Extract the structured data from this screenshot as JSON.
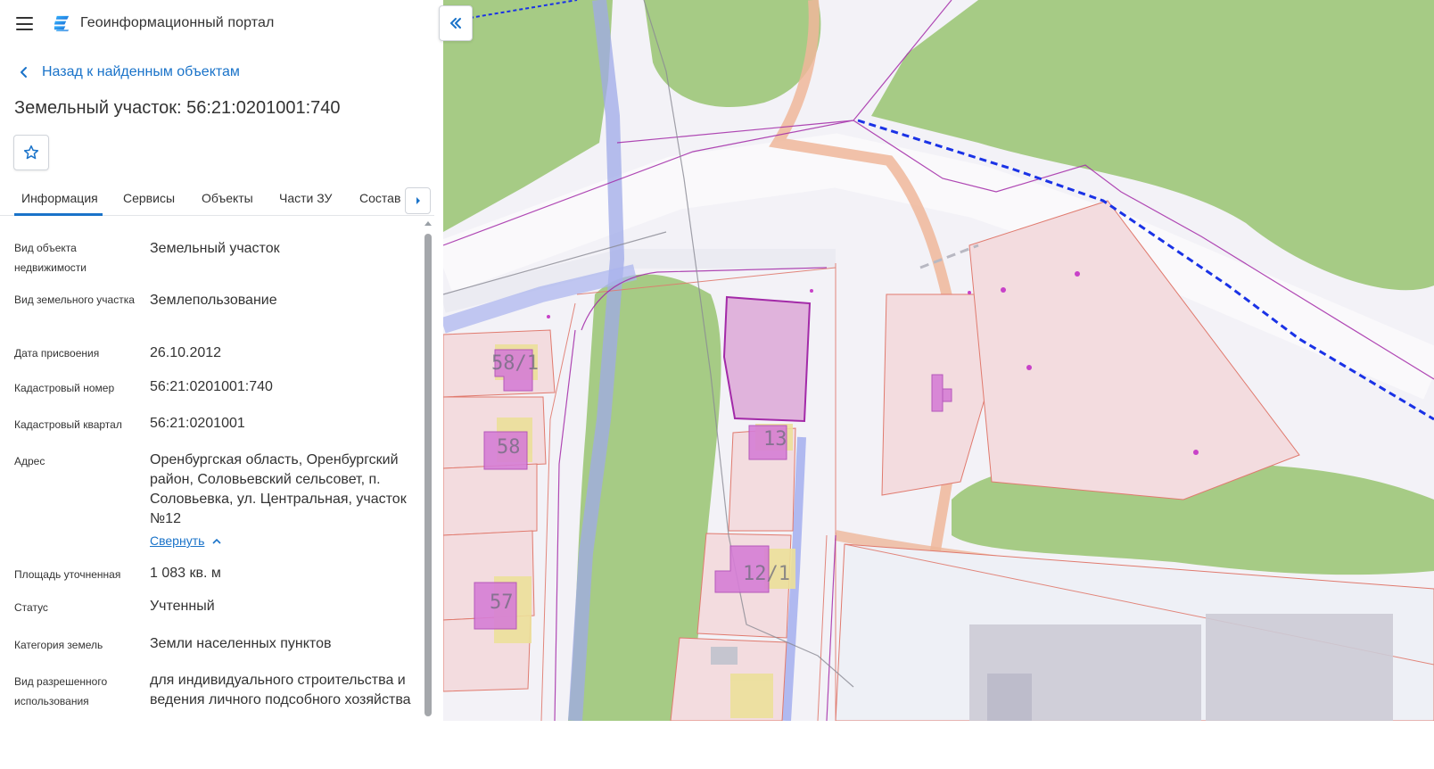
{
  "header": {
    "app_title": "Геоинформационный портал"
  },
  "nav": {
    "back_label": "Назад к найденным объектам"
  },
  "object": {
    "title": "Земельный участок: 56:21:0201001:740"
  },
  "tabs": [
    {
      "label": "Информация",
      "active": true
    },
    {
      "label": "Сервисы",
      "active": false
    },
    {
      "label": "Объекты",
      "active": false
    },
    {
      "label": "Части ЗУ",
      "active": false
    },
    {
      "label": "Состав",
      "active": false
    }
  ],
  "info": {
    "rows": [
      {
        "label": "Вид объекта недвижимости",
        "value": "Земельный участок"
      },
      {
        "label": "Вид земельного участка",
        "value": "Землепользование"
      },
      {
        "label": "Дата присвоения",
        "value": "26.10.2012"
      },
      {
        "label": "Кадастровый номер",
        "value": "56:21:0201001:740"
      },
      {
        "label": "Кадастровый квартал",
        "value": "56:21:0201001"
      },
      {
        "label": "Адрес",
        "value": "Оренбургская область, Оренбургский район, Соловьевский сельсовет, п. Соловьевка, ул. Центральная, участок №12"
      },
      {
        "label": "Площадь уточненная",
        "value": "1 083 кв. м"
      },
      {
        "label": "Статус",
        "value": "Учтенный"
      },
      {
        "label": "Категория земель",
        "value": "Земли населенных пунктов"
      },
      {
        "label": "Вид разрешенного использования",
        "value": "для индивидуального строительства и ведения личного подсобного хозяйства"
      }
    ],
    "collapse_label": "Свернуть"
  },
  "map": {
    "labels": {
      "house_58_1": "58/1",
      "house_58": "58",
      "house_57": "57",
      "house_13": "13",
      "house_12_1": "12/1"
    },
    "colors": {
      "vegetation": "#a6cb85",
      "parcel_fill": "#f3dcdf",
      "parcel_stroke": "#e07a6e",
      "selected_fill": "#e0b3dc",
      "selected_stroke": "#a32aa8",
      "building": "#d67ed6",
      "building_yellow": "#ece09a",
      "road_blue": "#b5bff0",
      "boundary_blue": "#1a32e6",
      "road_orange": "#eeb79a"
    }
  },
  "icons": {
    "menu": "hamburger-icon",
    "logo": "portal-logo-icon",
    "back": "chevron-left-icon",
    "favorite": "star-outline-icon",
    "tabs_next": "caret-right-icon",
    "collapse_map": "double-chevron-left-icon",
    "collapse_address": "chevron-up-icon"
  }
}
